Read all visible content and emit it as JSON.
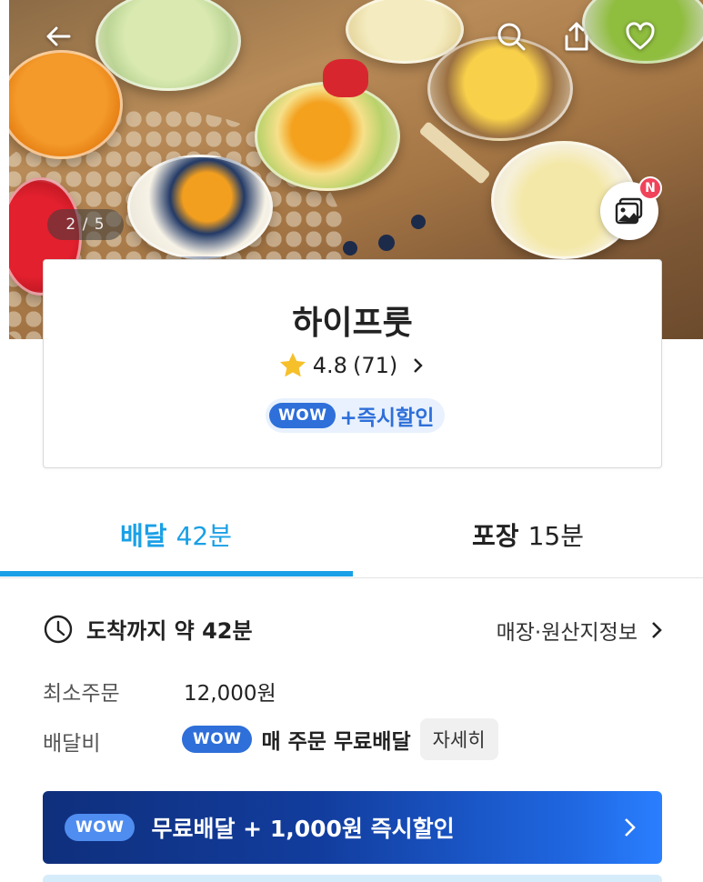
{
  "hero": {
    "page_indicator": "2 / 5",
    "new_badge": "N"
  },
  "store": {
    "name": "하이프룻",
    "rating": "4.8",
    "review_count": "(71)",
    "wow_label": "WOW",
    "promo": "+즉시할인"
  },
  "tabs": {
    "delivery_label": "배달",
    "delivery_time": "42분",
    "pickup_label": "포장",
    "pickup_time": "15분"
  },
  "info": {
    "arrival": "도착까지 약 42분",
    "origin_link": "매장·원산지정보",
    "min_order_label": "최소주문",
    "min_order_value": "12,000원",
    "delivery_fee_label": "배달비",
    "wow_label": "WOW",
    "delivery_fee_value": "매 주문 무료배달",
    "detail_button": "자세히"
  },
  "banner": {
    "wow_label": "WOW",
    "text": "무료배달 + 1,000원 즉시할인"
  },
  "colors": {
    "accent": "#1aa0e6",
    "wow_blue": "#2e6fd9",
    "badge_red": "#f0435a"
  },
  "icons": [
    "back-arrow-icon",
    "search-icon",
    "share-icon",
    "heart-icon",
    "gallery-icon",
    "star-icon",
    "clock-icon",
    "chevron-right-icon"
  ]
}
